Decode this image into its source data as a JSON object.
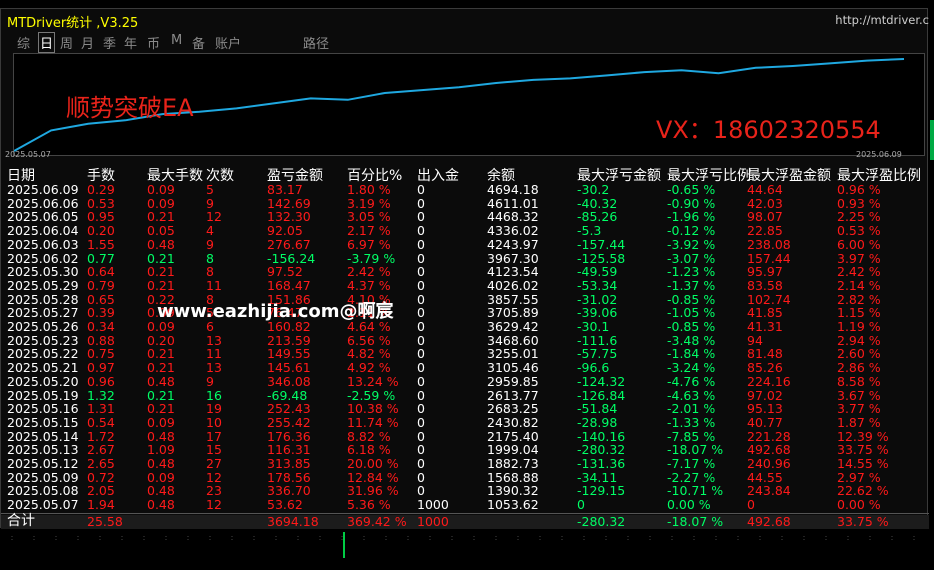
{
  "window": {
    "title": "MTDriver统计 ,V3.25",
    "url": "http://mtdriver.c"
  },
  "tabs": [
    {
      "label": "综",
      "active": false
    },
    {
      "label": "日",
      "active": true
    },
    {
      "label": "周",
      "active": false
    },
    {
      "label": "月",
      "active": false
    },
    {
      "label": "季",
      "active": false
    },
    {
      "label": "年",
      "active": false
    },
    {
      "label": "币",
      "active": false
    },
    {
      "label": "M",
      "active": false
    },
    {
      "label": "备",
      "active": false
    },
    {
      "label": "账户",
      "active": false
    },
    {
      "label": "路径",
      "active": false
    }
  ],
  "chart": {
    "start_date": "2025.05.07",
    "end_date": "2025.06.09",
    "line_color": "#1fa8e0"
  },
  "watermarks": {
    "ea_name": "顺势突破EA",
    "contact": "VX：18602320554",
    "site": "www.eazhijia.com@啊宸"
  },
  "columns": [
    "日期",
    "手数",
    "最大手数",
    "次数",
    "盈亏金额",
    "百分比%",
    "出入金",
    "余额",
    "最大浮亏金额",
    "最大浮亏比例",
    "最大浮盈金额",
    "最大浮盈比例"
  ],
  "rows": [
    {
      "date": "2025.06.09",
      "lots": "0.29",
      "max_lots": "0.09",
      "count": "5",
      "pnl": "83.17",
      "pct": "1.80 %",
      "io": "0",
      "bal": "4694.18",
      "fl_amt": "-30.2",
      "fl_pct": "-0.65 %",
      "fp_amt": "44.64",
      "fp_pct": "0.96 %",
      "profit": true
    },
    {
      "date": "2025.06.06",
      "lots": "0.53",
      "max_lots": "0.09",
      "count": "9",
      "pnl": "142.69",
      "pct": "3.19 %",
      "io": "0",
      "bal": "4611.01",
      "fl_amt": "-40.32",
      "fl_pct": "-0.90 %",
      "fp_amt": "42.03",
      "fp_pct": "0.93 %",
      "profit": true
    },
    {
      "date": "2025.06.05",
      "lots": "0.95",
      "max_lots": "0.21",
      "count": "12",
      "pnl": "132.30",
      "pct": "3.05 %",
      "io": "0",
      "bal": "4468.32",
      "fl_amt": "-85.26",
      "fl_pct": "-1.96 %",
      "fp_amt": "98.07",
      "fp_pct": "2.25 %",
      "profit": true
    },
    {
      "date": "2025.06.04",
      "lots": "0.20",
      "max_lots": "0.05",
      "count": "4",
      "pnl": "92.05",
      "pct": "2.17 %",
      "io": "0",
      "bal": "4336.02",
      "fl_amt": "-5.3",
      "fl_pct": "-0.12 %",
      "fp_amt": "22.85",
      "fp_pct": "0.53 %",
      "profit": true
    },
    {
      "date": "2025.06.03",
      "lots": "1.55",
      "max_lots": "0.48",
      "count": "9",
      "pnl": "276.67",
      "pct": "6.97 %",
      "io": "0",
      "bal": "4243.97",
      "fl_amt": "-157.44",
      "fl_pct": "-3.92 %",
      "fp_amt": "238.08",
      "fp_pct": "6.00 %",
      "profit": true
    },
    {
      "date": "2025.06.02",
      "lots": "0.77",
      "max_lots": "0.21",
      "count": "8",
      "pnl": "-156.24",
      "pct": "-3.79 %",
      "io": "0",
      "bal": "3967.30",
      "fl_amt": "-125.58",
      "fl_pct": "-3.07 %",
      "fp_amt": "157.44",
      "fp_pct": "3.97 %",
      "profit": false
    },
    {
      "date": "2025.05.30",
      "lots": "0.64",
      "max_lots": "0.21",
      "count": "8",
      "pnl": "97.52",
      "pct": "2.42 %",
      "io": "0",
      "bal": "4123.54",
      "fl_amt": "-49.59",
      "fl_pct": "-1.23 %",
      "fp_amt": "95.97",
      "fp_pct": "2.42 %",
      "profit": true
    },
    {
      "date": "2025.05.29",
      "lots": "0.79",
      "max_lots": "0.21",
      "count": "11",
      "pnl": "168.47",
      "pct": "4.37 %",
      "io": "0",
      "bal": "4026.02",
      "fl_amt": "-53.34",
      "fl_pct": "-1.37 %",
      "fp_amt": "83.58",
      "fp_pct": "2.14 %",
      "profit": true
    },
    {
      "date": "2025.05.28",
      "lots": "0.65",
      "max_lots": "0.22",
      "count": "8",
      "pnl": "151.86",
      "pct": "4.10 %",
      "io": "0",
      "bal": "3857.55",
      "fl_amt": "-31.02",
      "fl_pct": "-0.85 %",
      "fp_amt": "102.74",
      "fp_pct": "2.82 %",
      "profit": true
    },
    {
      "date": "2025.05.27",
      "lots": "0.39",
      "max_lots": "0.09",
      "count": "5",
      "pnl": "76.47",
      "pct": "2.11 %",
      "io": "0",
      "bal": "3705.89",
      "fl_amt": "-39.06",
      "fl_pct": "-1.05 %",
      "fp_amt": "41.85",
      "fp_pct": "1.15 %",
      "profit": true
    },
    {
      "date": "2025.05.26",
      "lots": "0.34",
      "max_lots": "0.09",
      "count": "6",
      "pnl": "160.82",
      "pct": "4.64 %",
      "io": "0",
      "bal": "3629.42",
      "fl_amt": "-30.1",
      "fl_pct": "-0.85 %",
      "fp_amt": "41.31",
      "fp_pct": "1.19 %",
      "profit": true
    },
    {
      "date": "2025.05.23",
      "lots": "0.88",
      "max_lots": "0.20",
      "count": "13",
      "pnl": "213.59",
      "pct": "6.56 %",
      "io": "0",
      "bal": "3468.60",
      "fl_amt": "-111.6",
      "fl_pct": "-3.48 %",
      "fp_amt": "94",
      "fp_pct": "2.94 %",
      "profit": true
    },
    {
      "date": "2025.05.22",
      "lots": "0.75",
      "max_lots": "0.21",
      "count": "11",
      "pnl": "149.55",
      "pct": "4.82 %",
      "io": "0",
      "bal": "3255.01",
      "fl_amt": "-57.75",
      "fl_pct": "-1.84 %",
      "fp_amt": "81.48",
      "fp_pct": "2.60 %",
      "profit": true
    },
    {
      "date": "2025.05.21",
      "lots": "0.97",
      "max_lots": "0.21",
      "count": "13",
      "pnl": "145.61",
      "pct": "4.92 %",
      "io": "0",
      "bal": "3105.46",
      "fl_amt": "-96.6",
      "fl_pct": "-3.24 %",
      "fp_amt": "85.26",
      "fp_pct": "2.86 %",
      "profit": true
    },
    {
      "date": "2025.05.20",
      "lots": "0.96",
      "max_lots": "0.48",
      "count": "9",
      "pnl": "346.08",
      "pct": "13.24 %",
      "io": "0",
      "bal": "2959.85",
      "fl_amt": "-124.32",
      "fl_pct": "-4.76 %",
      "fp_amt": "224.16",
      "fp_pct": "8.58 %",
      "profit": true
    },
    {
      "date": "2025.05.19",
      "lots": "1.32",
      "max_lots": "0.21",
      "count": "16",
      "pnl": "-69.48",
      "pct": "-2.59 %",
      "io": "0",
      "bal": "2613.77",
      "fl_amt": "-126.84",
      "fl_pct": "-4.63 %",
      "fp_amt": "97.02",
      "fp_pct": "3.67 %",
      "profit": false
    },
    {
      "date": "2025.05.16",
      "lots": "1.31",
      "max_lots": "0.21",
      "count": "19",
      "pnl": "252.43",
      "pct": "10.38 %",
      "io": "0",
      "bal": "2683.25",
      "fl_amt": "-51.84",
      "fl_pct": "-2.01 %",
      "fp_amt": "95.13",
      "fp_pct": "3.77 %",
      "profit": true
    },
    {
      "date": "2025.05.15",
      "lots": "0.54",
      "max_lots": "0.09",
      "count": "10",
      "pnl": "255.42",
      "pct": "11.74 %",
      "io": "0",
      "bal": "2430.82",
      "fl_amt": "-28.98",
      "fl_pct": "-1.33 %",
      "fp_amt": "40.77",
      "fp_pct": "1.87 %",
      "profit": true
    },
    {
      "date": "2025.05.14",
      "lots": "1.72",
      "max_lots": "0.48",
      "count": "17",
      "pnl": "176.36",
      "pct": "8.82 %",
      "io": "0",
      "bal": "2175.40",
      "fl_amt": "-140.16",
      "fl_pct": "-7.85 %",
      "fp_amt": "221.28",
      "fp_pct": "12.39 %",
      "profit": true
    },
    {
      "date": "2025.05.13",
      "lots": "2.67",
      "max_lots": "1.09",
      "count": "15",
      "pnl": "116.31",
      "pct": "6.18 %",
      "io": "0",
      "bal": "1999.04",
      "fl_amt": "-280.32",
      "fl_pct": "-18.07 %",
      "fp_amt": "492.68",
      "fp_pct": "33.75 %",
      "profit": true
    },
    {
      "date": "2025.05.12",
      "lots": "2.65",
      "max_lots": "0.48",
      "count": "27",
      "pnl": "313.85",
      "pct": "20.00 %",
      "io": "0",
      "bal": "1882.73",
      "fl_amt": "-131.36",
      "fl_pct": "-7.17 %",
      "fp_amt": "240.96",
      "fp_pct": "14.55 %",
      "profit": true
    },
    {
      "date": "2025.05.09",
      "lots": "0.72",
      "max_lots": "0.09",
      "count": "12",
      "pnl": "178.56",
      "pct": "12.84 %",
      "io": "0",
      "bal": "1568.88",
      "fl_amt": "-34.11",
      "fl_pct": "-2.27 %",
      "fp_amt": "44.55",
      "fp_pct": "2.97 %",
      "profit": true
    },
    {
      "date": "2025.05.08",
      "lots": "2.05",
      "max_lots": "0.48",
      "count": "23",
      "pnl": "336.70",
      "pct": "31.96 %",
      "io": "0",
      "bal": "1390.32",
      "fl_amt": "-129.15",
      "fl_pct": "-10.71 %",
      "fp_amt": "243.84",
      "fp_pct": "22.62 %",
      "profit": true
    },
    {
      "date": "2025.05.07",
      "lots": "1.94",
      "max_lots": "0.48",
      "count": "12",
      "pnl": "53.62",
      "pct": "5.36 %",
      "io": "1000",
      "bal": "1053.62",
      "fl_amt": "0",
      "fl_pct": "0.00 %",
      "fp_amt": "0",
      "fp_pct": "0.00 %",
      "profit": true
    }
  ],
  "total": {
    "label": "合计",
    "lots": "25.58",
    "pnl": "3694.18",
    "pct": "369.42 %",
    "io": "1000",
    "fl_amt": "-280.32",
    "fl_pct": "-18.07 %",
    "fp_amt": "492.68",
    "fp_pct": "33.75 %"
  }
}
